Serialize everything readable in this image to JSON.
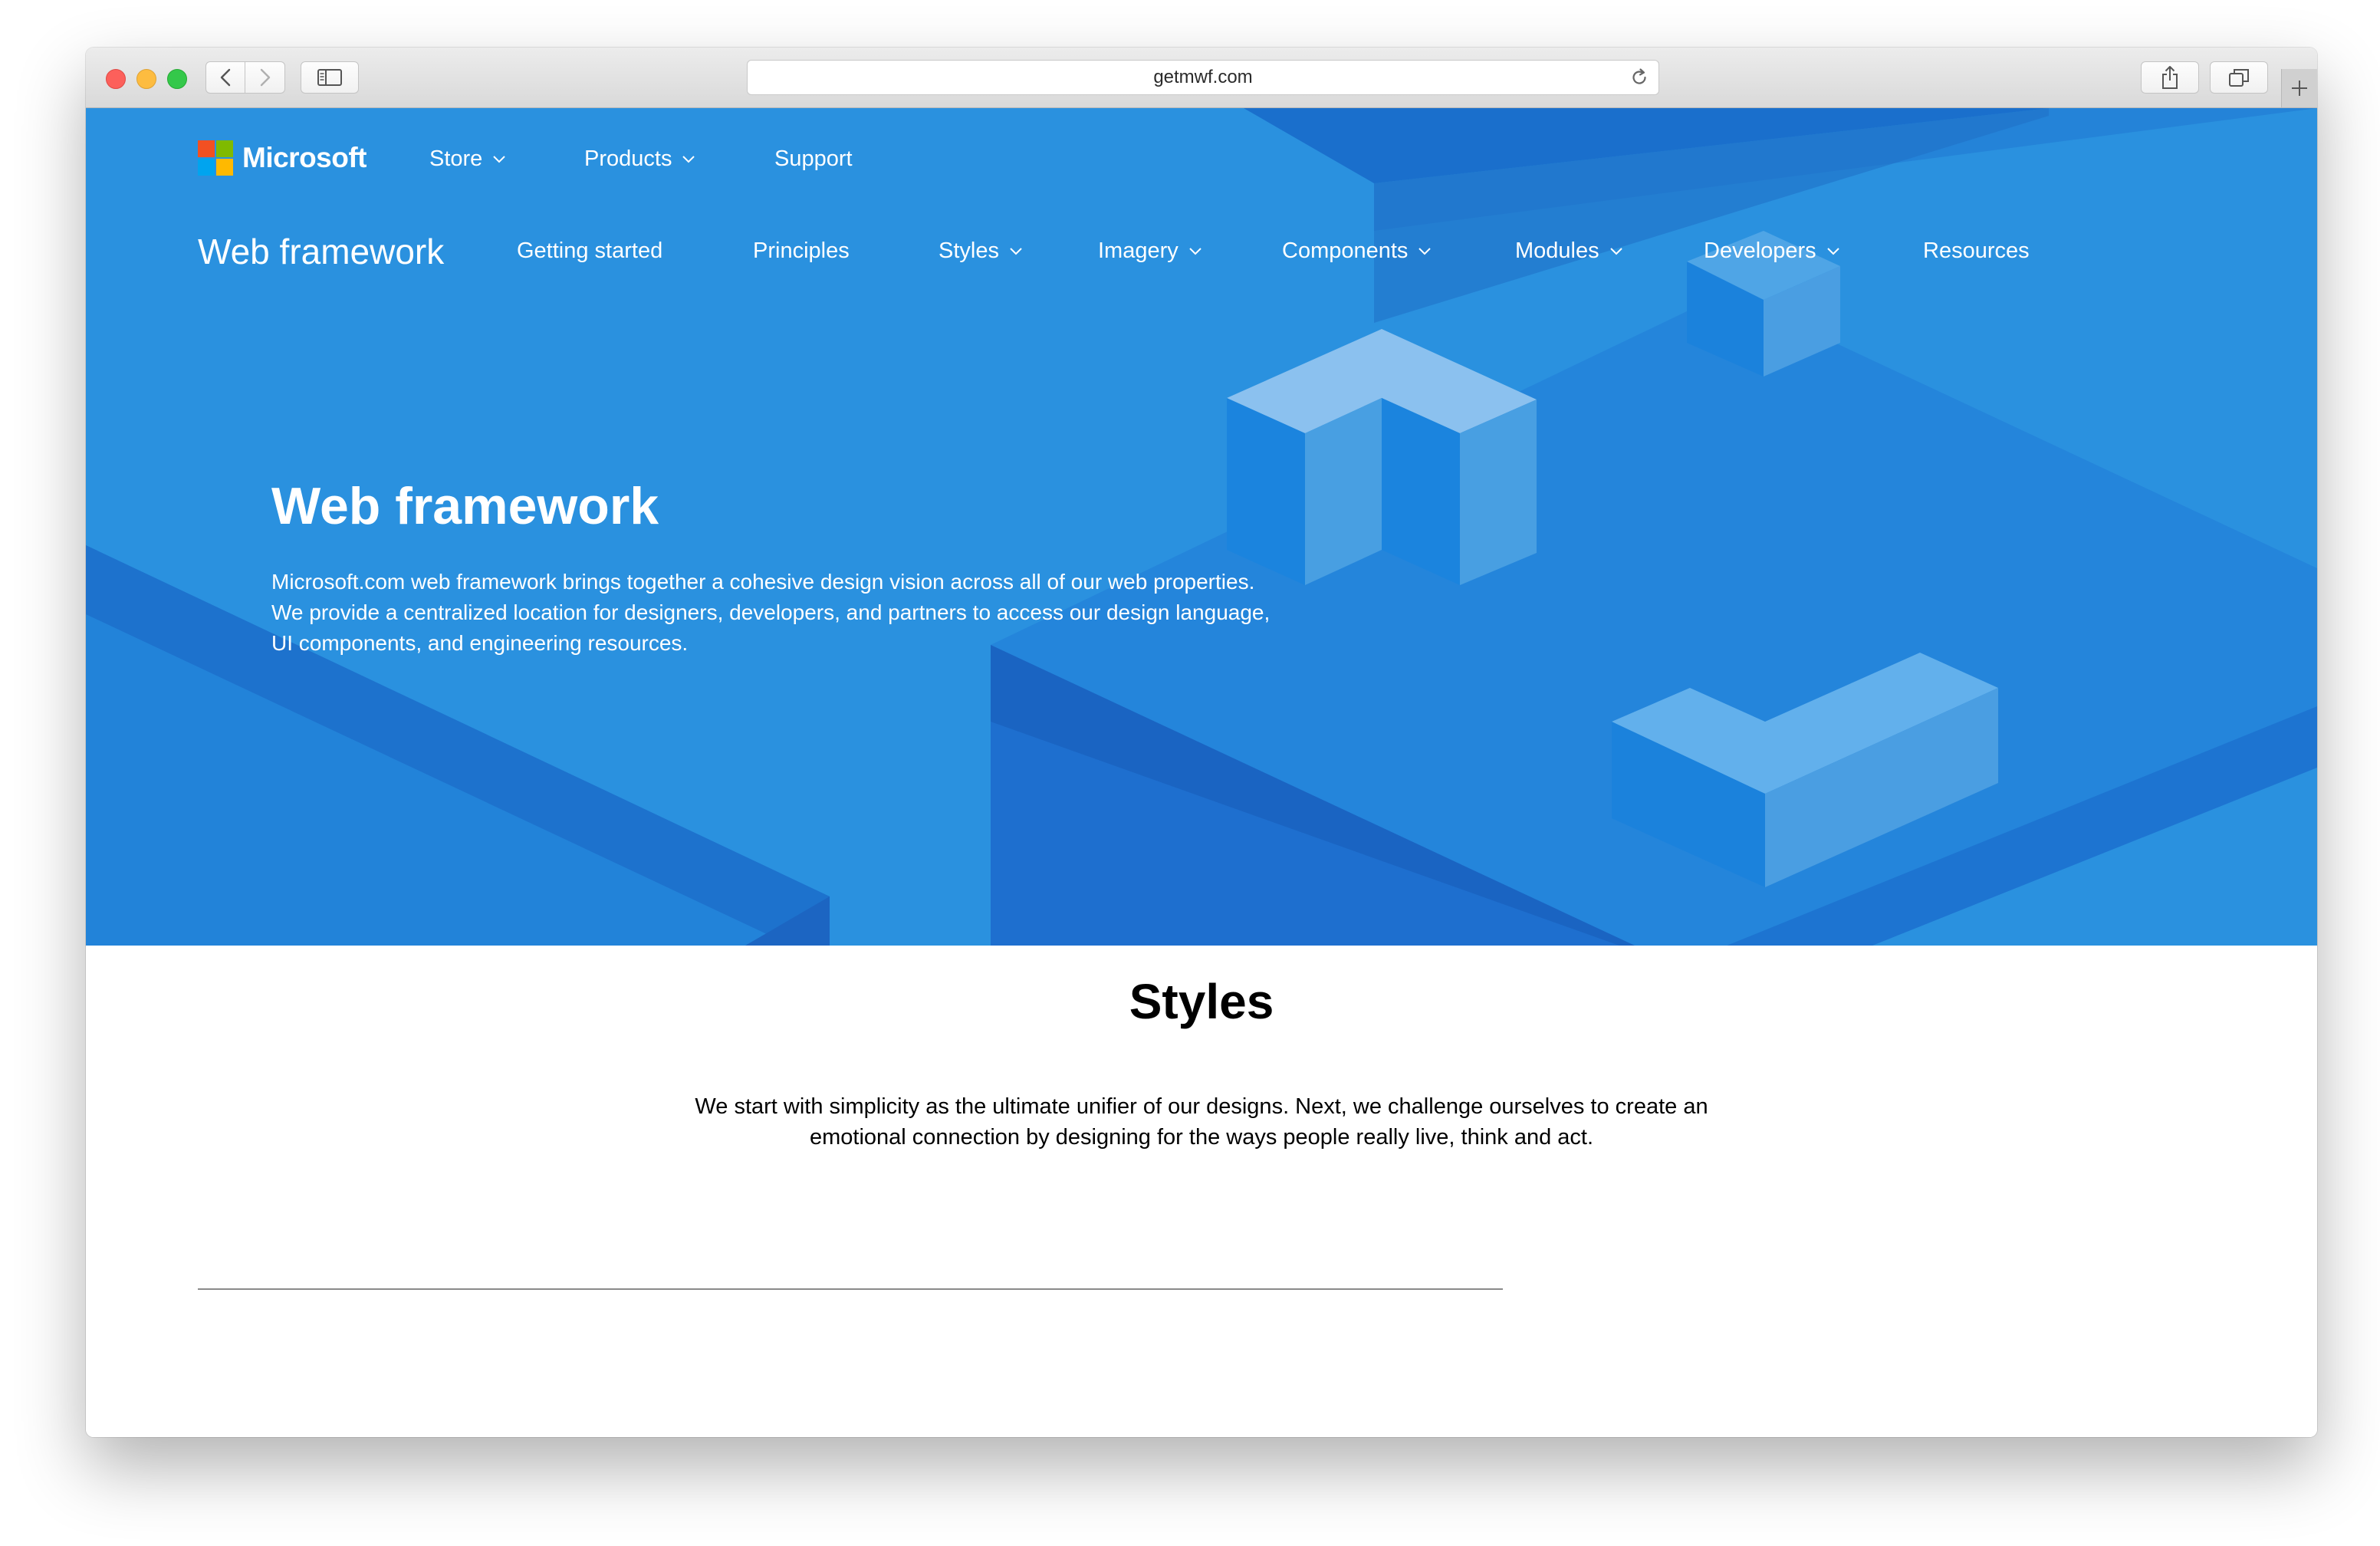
{
  "browser": {
    "url": "getmwf.com"
  },
  "colors": {
    "hero_background": "#2a91df",
    "ms_red": "#f25022",
    "ms_green": "#7fba00",
    "ms_blue": "#00a4ef",
    "ms_yellow": "#ffb900"
  },
  "header": {
    "brand": "Microsoft",
    "top_nav": [
      {
        "label": "Store",
        "has_dropdown": true
      },
      {
        "label": "Products",
        "has_dropdown": true
      },
      {
        "label": "Support",
        "has_dropdown": false
      }
    ],
    "subnav_brand": "Web framework",
    "sub_nav": [
      {
        "label": "Getting started",
        "has_dropdown": false
      },
      {
        "label": "Principles",
        "has_dropdown": false
      },
      {
        "label": "Styles",
        "has_dropdown": true
      },
      {
        "label": "Imagery",
        "has_dropdown": true
      },
      {
        "label": "Components",
        "has_dropdown": true
      },
      {
        "label": "Modules",
        "has_dropdown": true
      },
      {
        "label": "Developers",
        "has_dropdown": true
      },
      {
        "label": "Resources",
        "has_dropdown": false
      }
    ]
  },
  "hero": {
    "title": "Web framework",
    "description_lines": [
      "Microsoft.com web framework brings together a cohesive design vision across all of our web properties.",
      "We provide a centralized location for designers, developers, and partners to access our design language,",
      "UI components, and engineering resources."
    ]
  },
  "styles_section": {
    "title": "Styles",
    "description_lines": [
      "We start with simplicity as the ultimate unifier of our designs. Next, we challenge ourselves to create an",
      "emotional connection by designing for the ways people really live, think and act."
    ]
  }
}
